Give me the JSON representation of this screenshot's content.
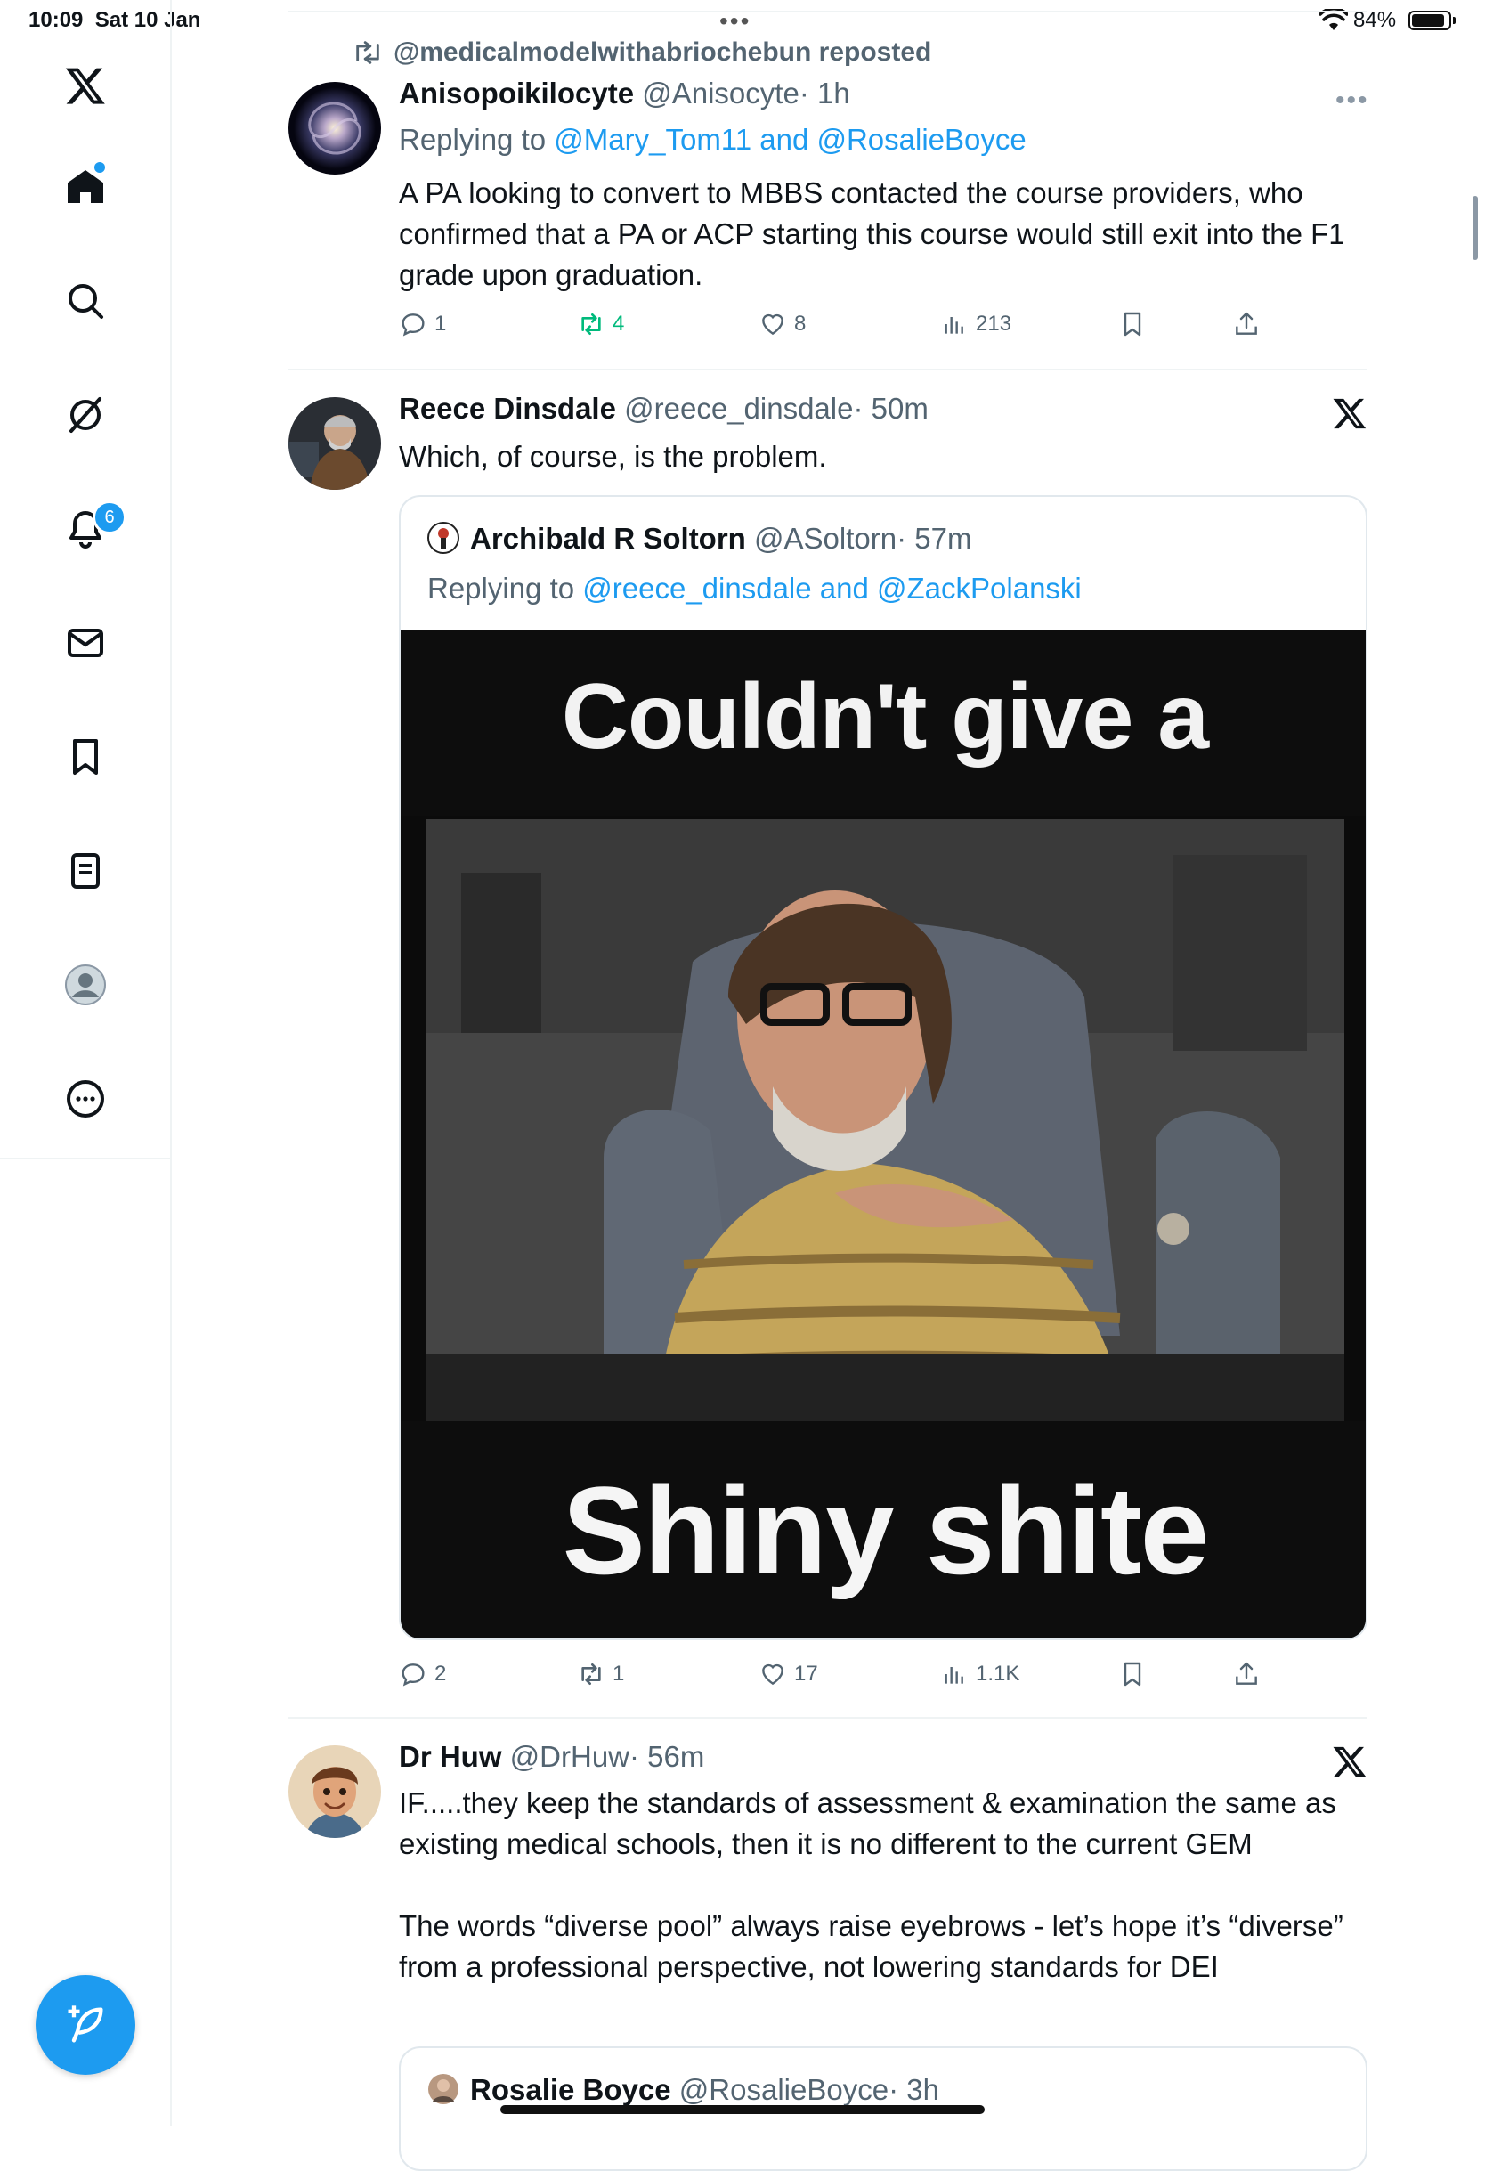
{
  "status_bar": {
    "time": "10:09",
    "date": "Sat 10 Jan",
    "battery": "84%"
  },
  "sidebar": {
    "notifications_badge": "6",
    "items": [
      "x-logo",
      "home",
      "search",
      "grok",
      "notifications",
      "messages",
      "bookmarks",
      "lists",
      "profile",
      "more"
    ]
  },
  "tweets": [
    {
      "repost_label": "@medicalmodelwithabriochebun reposted",
      "name": "Anisopoikilocyte",
      "handle": "@Anisocyte",
      "time": "· 1h",
      "replying_prefix": "Replying to",
      "replying_to": "@Mary_Tom11 and @RosalieBoyce",
      "text": "A PA looking to convert to MBBS contacted the course providers, who confirmed that a PA or ACP starting this course would still exit into the F1 grade upon graduation.",
      "replies": "1",
      "reposts": "4",
      "likes": "8",
      "views": "213"
    },
    {
      "name": "Reece Dinsdale",
      "handle": "@reece_dinsdale",
      "time": "· 50m",
      "text": "Which, of course, is the problem.",
      "quote": {
        "name": "Archibald R Soltorn",
        "handle": "@ASoltorn",
        "time": "· 57m",
        "replying_prefix": "Replying to",
        "replying_to": "@reece_dinsdale and @ZackPolanski",
        "meme_top": "Couldn't give a",
        "meme_bottom": "Shiny shite"
      },
      "replies": "2",
      "reposts": "1",
      "likes": "17",
      "views": "1.1K"
    },
    {
      "name": "Dr Huw",
      "handle": "@DrHuw",
      "time": "· 56m",
      "text1": "IF.....they keep the standards of assessment & examination the same as existing medical schools, then it is no different to the current GEM",
      "text2": "The words “diverse pool” always raise eyebrows - let’s hope it’s “diverse” from a professional perspective, not lowering standards for DEI",
      "quote": {
        "name": "Rosalie Boyce",
        "handle": "@RosalieBoyce",
        "time": "· 3h"
      }
    }
  ],
  "colors": {
    "accent": "#1d9bf0",
    "repost_active": "#00ba7c",
    "muted": "#536471"
  }
}
